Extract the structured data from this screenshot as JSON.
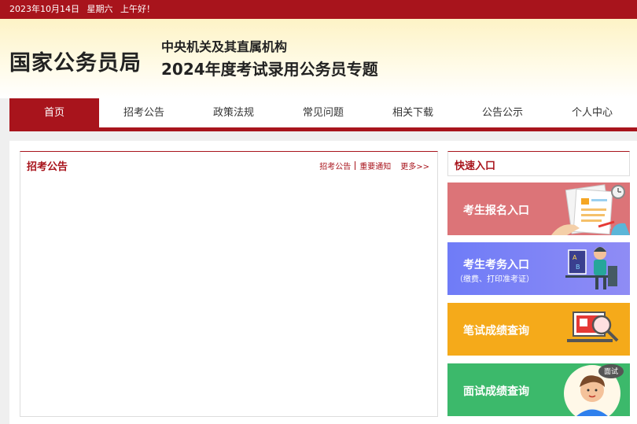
{
  "topbar": {
    "date": "2023年10月14日",
    "weekday": "星期六",
    "greeting": "上午好！"
  },
  "header": {
    "site_name": "国家公务员局",
    "sub_org": "中央机关及其直属机构",
    "sub_title": "2024年度考试录用公务员专题"
  },
  "nav": {
    "items": [
      {
        "label": "首页"
      },
      {
        "label": "招考公告"
      },
      {
        "label": "政策法规"
      },
      {
        "label": "常见问题"
      },
      {
        "label": "相关下载"
      },
      {
        "label": "公告公示"
      },
      {
        "label": "个人中心"
      }
    ]
  },
  "announcements": {
    "title": "招考公告",
    "links": [
      "招考公告",
      "重要通知"
    ],
    "more": "更多>>"
  },
  "quick_entry": {
    "title": "快速入口",
    "buttons": [
      {
        "label": "考生报名入口"
      },
      {
        "label": "考生考务入口",
        "sublabel": "（缴费、打印准考证）"
      },
      {
        "label": "笔试成绩查询"
      },
      {
        "label": "面试成绩查询",
        "badge": "面试"
      }
    ]
  },
  "colors": {
    "brand_red": "#a8141c",
    "pink": "#dc7478",
    "purple": "#7b84f6",
    "orange": "#f5aa1a",
    "green": "#3cb96b"
  }
}
